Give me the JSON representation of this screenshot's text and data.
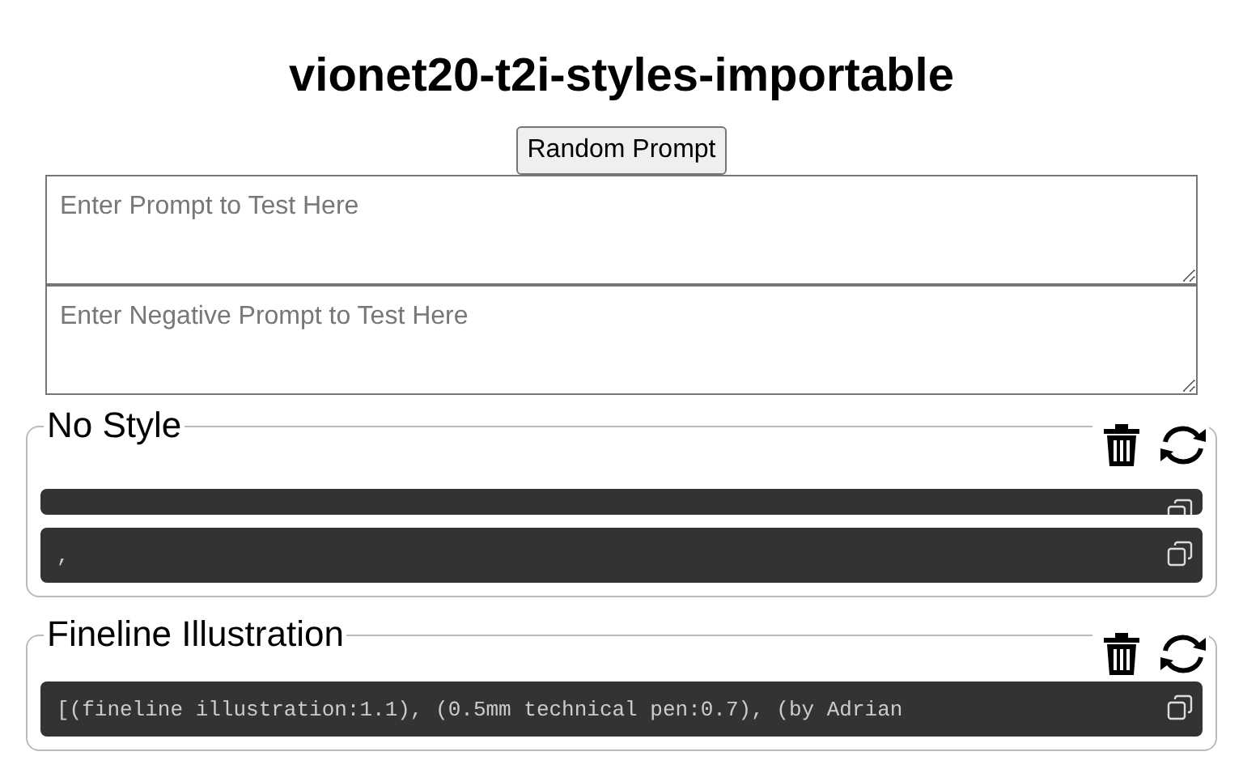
{
  "title": "vionet20-t2i-styles-importable",
  "random_button": "Random Prompt",
  "prompt_field": {
    "placeholder": "Enter Prompt to Test Here"
  },
  "negative_prompt_field": {
    "placeholder": "Enter Negative Prompt to Test Here"
  },
  "styles": [
    {
      "name": "No Style",
      "outputs": [
        {
          "kind": "empty"
        },
        {
          "kind": "text",
          "text": ","
        }
      ]
    },
    {
      "name": "Fineline Illustration",
      "outputs": [
        {
          "kind": "text",
          "text": "[(fineline illustration:1.1), (0.5mm technical pen:0.7), (by Adrian"
        }
      ]
    }
  ]
}
